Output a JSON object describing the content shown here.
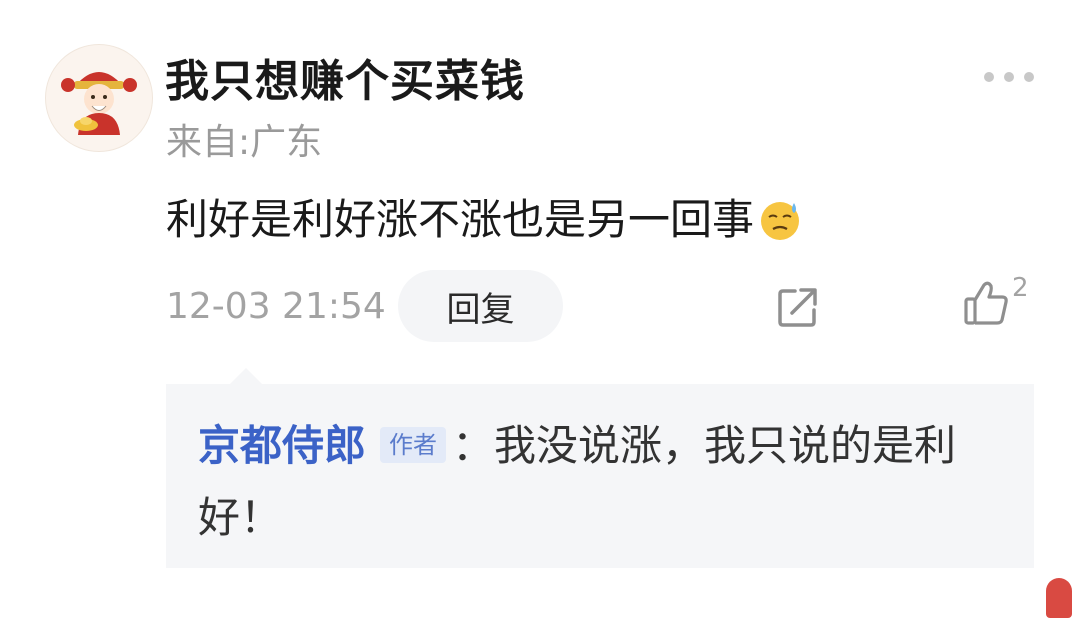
{
  "comment": {
    "username": "我只想赚个买菜钱",
    "location": "来自:广东",
    "text": "利好是利好涨不涨也是另一回事",
    "emoji": "sweat-smile-emoji",
    "timestamp": "12-03 21:54",
    "reply_label": "回复",
    "like_count": "2"
  },
  "reply": {
    "author": "京都侍郎",
    "badge": "作者",
    "separator": "：",
    "text": "我没说涨，我只说的是利好！"
  },
  "icons": {
    "more": "more-dots-icon",
    "share": "share-icon",
    "like": "thumbs-up-icon"
  },
  "colors": {
    "author_link": "#3b62c7",
    "muted_text": "#9a9a9a",
    "reply_background": "#f5f6f8"
  }
}
